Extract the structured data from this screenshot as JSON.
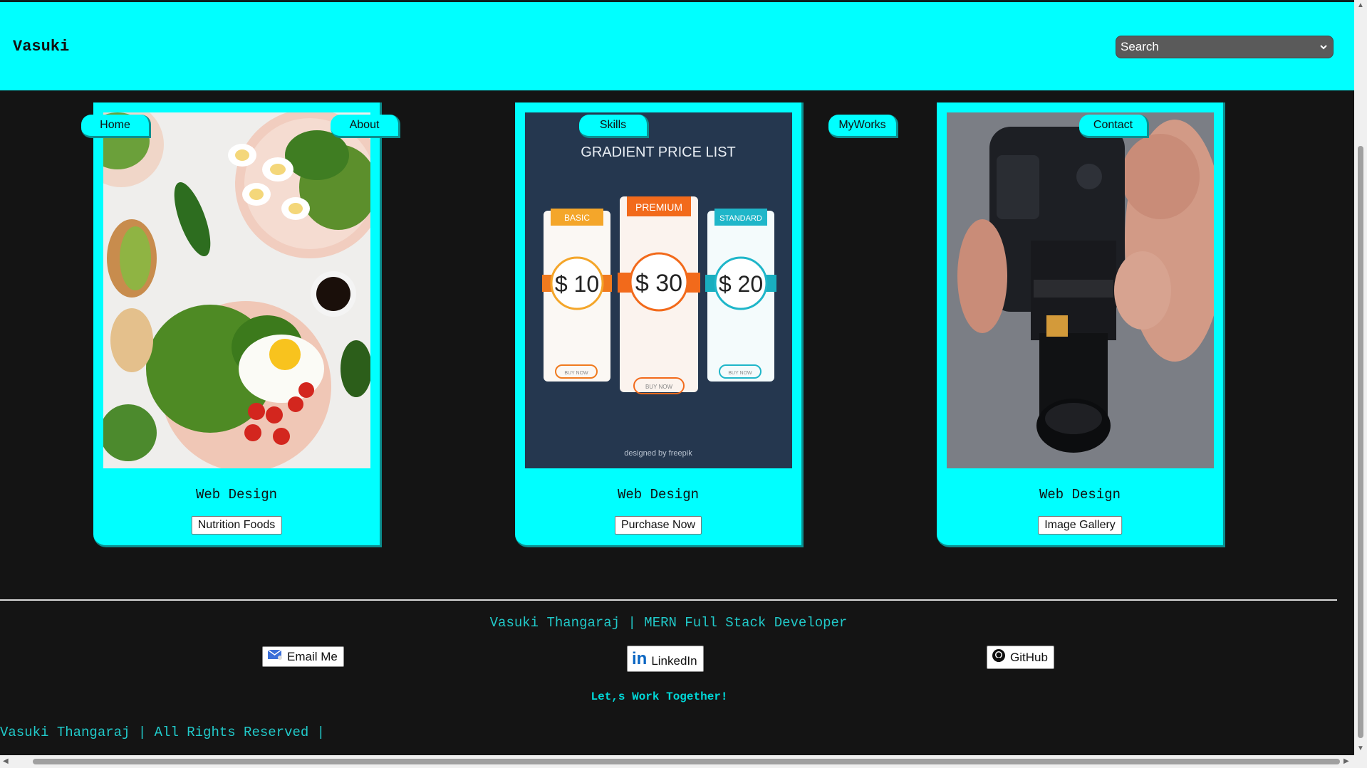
{
  "header": {
    "brand": "Vasuki",
    "search_value": "Search"
  },
  "nav": {
    "home": "Home",
    "about": "About",
    "skills": "Skills",
    "myworks": "MyWorks",
    "contact": "Contact"
  },
  "cards": [
    {
      "title": "Web Design",
      "button": "Nutrition Foods"
    },
    {
      "title": "Web Design",
      "button": "Purchase Now"
    },
    {
      "title": "Web Design",
      "button": "Image Gallery"
    }
  ],
  "pricing_image": {
    "heading": "GRADIENT PRICE LIST",
    "plans": [
      {
        "name": "BASIC",
        "price": "$ 10",
        "cta": "BUY NOW"
      },
      {
        "name": "PREMIUM",
        "price": "$ 30",
        "cta": "BUY NOW"
      },
      {
        "name": "STANDARD",
        "price": "$ 20",
        "cta": "BUY NOW"
      }
    ],
    "credit": "designed by freepik"
  },
  "footer": {
    "name_line": "Vasuki Thangaraj | MERN Full Stack Developer",
    "email_label": "Email Me",
    "linkedin_label": "LinkedIn",
    "github_label": "GitHub",
    "tagline": "Let,s Work Together!",
    "copyright": "Vasuki Thangaraj | All Rights Reserved |"
  },
  "colors": {
    "accent": "#00ffff",
    "background": "#141414",
    "footer_text": "#21c9c9"
  }
}
